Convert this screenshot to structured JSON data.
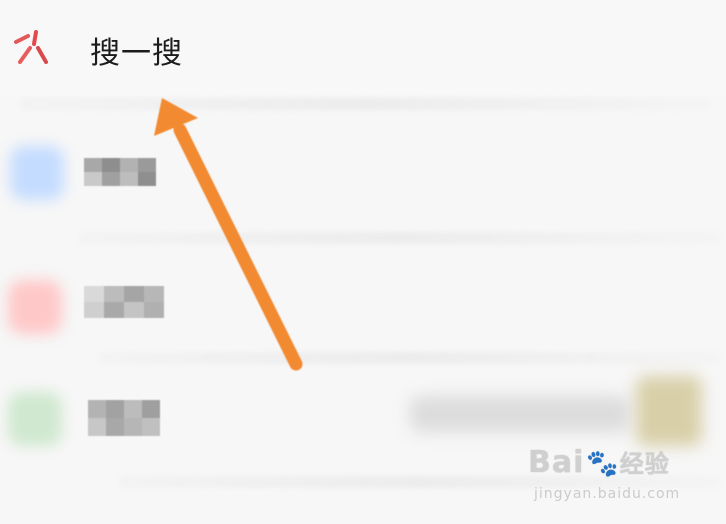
{
  "header": {
    "title": "搜一搜",
    "icon": "spark-icon",
    "icon_color": "#e04a4a"
  },
  "list": {
    "rows": [
      {
        "avatar_color": "#b9d7ff",
        "label_hidden": true
      },
      {
        "avatar_color": "#ffc4c4",
        "label_hidden": true
      },
      {
        "avatar_color": "#c8e6c8",
        "label_hidden": true
      }
    ]
  },
  "annotation": {
    "arrow_color": "#f28a30"
  },
  "watermark": {
    "main": "Bai",
    "brand": "经验",
    "sub": "jingyan.baidu.com"
  }
}
